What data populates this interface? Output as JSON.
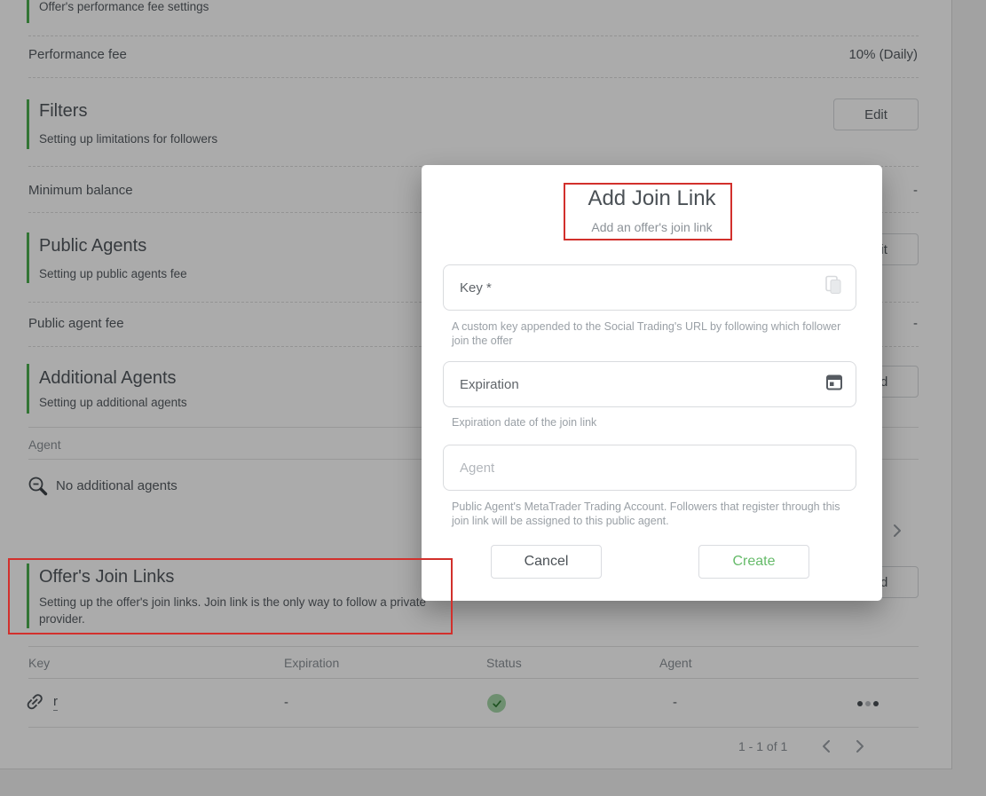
{
  "colors": {
    "accent_green": "#4caf50",
    "annotation_red": "#d2302c",
    "status_check_green": "#2e7d32",
    "status_circle_green": "#a5d6a7",
    "create_button_green": "#66bb6a"
  },
  "background": {
    "top_section_subtitle": "Offer's performance fee settings",
    "performance_fee": {
      "label": "Performance fee",
      "value": "10% (Daily)"
    },
    "filters": {
      "title": "Filters",
      "subtitle": "Setting up limitations for followers",
      "edit_label": "Edit"
    },
    "minimum_balance": {
      "label": "Minimum balance",
      "value": "-"
    },
    "public_agents": {
      "title": "Public Agents",
      "subtitle": "Setting up public agents fee",
      "edit_label": "Edit"
    },
    "public_agent_fee": {
      "label": "Public agent fee",
      "value": "-"
    },
    "additional_agents": {
      "title": "Additional Agents",
      "subtitle": "Setting up additional agents",
      "add_label": "Add",
      "agent_header": "Agent",
      "empty_text": "No additional agents"
    },
    "join_links": {
      "title": "Offer's Join Links",
      "subtitle": "Setting up the offer's join links. Join link is the only way to follow a private\nprovider.",
      "add_label": "Add",
      "headers": [
        "Key",
        "Expiration",
        "Status",
        "Agent"
      ],
      "row": {
        "key": "r",
        "expiration": "-",
        "agent": "-"
      },
      "pagination": "1 - 1 of 1"
    }
  },
  "modal": {
    "title": "Add Join Link",
    "subtitle": "Add an offer's join link",
    "key_field": {
      "label": "Key *",
      "helper": "A custom key appended to the Social Trading's URL by following which follower\njoin the offer"
    },
    "expiration_field": {
      "label": "Expiration",
      "helper": "Expiration date of the join link"
    },
    "agent_field": {
      "placeholder": "Agent",
      "helper": "Public Agent's MetaTrader Trading Account. Followers that register through this\njoin link will be assigned to this public agent."
    },
    "cancel_label": "Cancel",
    "create_label": "Create"
  },
  "icons": {
    "key_row": "link-icon",
    "empty_state": "zoom-out-icon",
    "status": "check-circle-icon",
    "row_menu": "ellipsis-icon",
    "key_field": "paste-icon",
    "expiration_field": "calendar-icon",
    "pagination_prev": "chevron-left-icon",
    "pagination_next": "chevron-right-icon"
  }
}
